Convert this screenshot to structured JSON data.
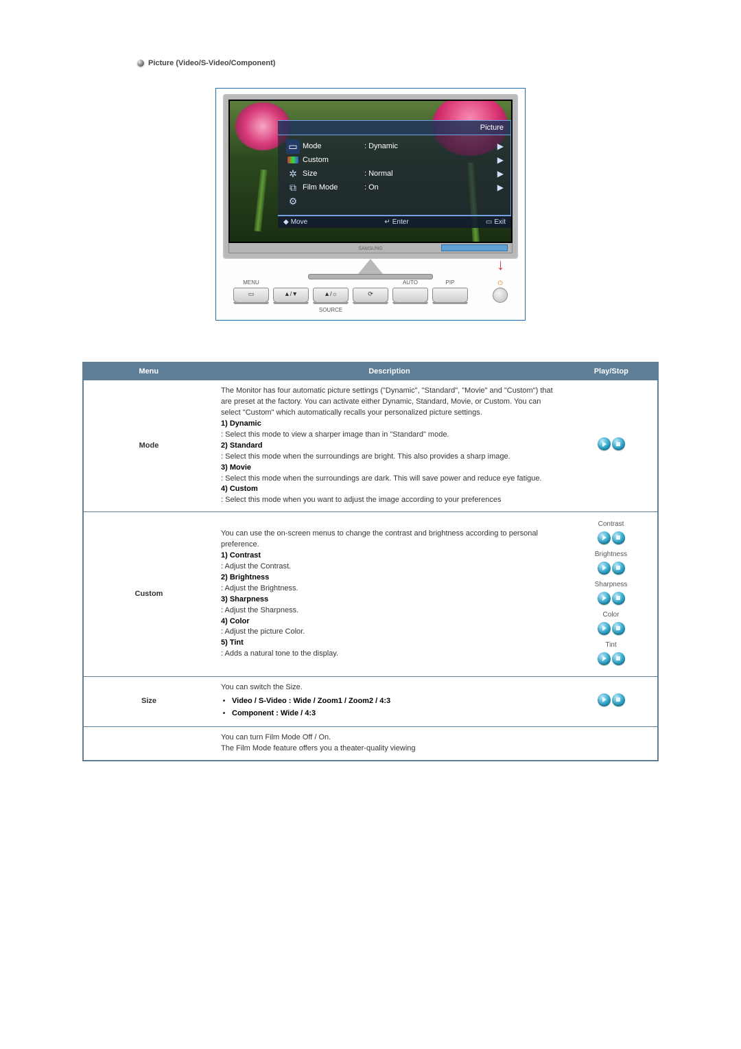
{
  "heading": "Picture (Video/S-Video/Component)",
  "osd": {
    "title": "Picture",
    "items": [
      {
        "label": "Mode",
        "value": ": Dynamic"
      },
      {
        "label": "Custom",
        "value": ""
      },
      {
        "label": "Size",
        "value": ": Normal"
      },
      {
        "label": "Film Mode",
        "value": ": On"
      }
    ],
    "footer": {
      "move": "Move",
      "enter": "Enter",
      "exit": "Exit"
    }
  },
  "remote": {
    "menu": "MENU",
    "auto": "AUTO",
    "pip": "PIP",
    "source": "SOURCE",
    "vol_nav": "▲/▼",
    "bright_nav": "▲/☼",
    "exit_icon": "⟳"
  },
  "monitor_brand": "SAMSUNG",
  "table": {
    "headers": {
      "menu": "Menu",
      "description": "Description",
      "play": "Play/Stop"
    },
    "rows": [
      {
        "menu": "Mode",
        "intro": "The Monitor has four automatic picture settings (\"Dynamic\", \"Standard\", \"Movie\" and \"Custom\") that are preset at the factory. You can activate either Dynamic, Standard, Movie, or Custom. You can select \"Custom\" which automatically recalls your personalized picture settings.",
        "opts": [
          {
            "t": "1) Dynamic",
            "d": ": Select this mode to view a sharper image than in \"Standard\" mode."
          },
          {
            "t": "2) Standard",
            "d": ": Select this mode when the surroundings are bright. This also provides a sharp image."
          },
          {
            "t": "3) Movie",
            "d": ": Select this mode when the surroundings are dark. This will save power and reduce eye fatigue."
          },
          {
            "t": "4) Custom",
            "d": ": Select this mode when you want to adjust the image according to your preferences"
          }
        ],
        "play": [
          {
            "label": ""
          }
        ]
      },
      {
        "menu": "Custom",
        "intro": "You can use the on-screen menus to change the contrast and brightness according to personal preference.",
        "opts": [
          {
            "t": "1) Contrast",
            "d": ": Adjust the Contrast."
          },
          {
            "t": "2) Brightness",
            "d": ": Adjust the Brightness."
          },
          {
            "t": "3) Sharpness",
            "d": ": Adjust the Sharpness."
          },
          {
            "t": "4) Color",
            "d": ": Adjust the picture Color."
          },
          {
            "t": "5) Tint",
            "d": ": Adds a natural tone to the display."
          }
        ],
        "play": [
          {
            "label": "Contrast"
          },
          {
            "label": "Brightness"
          },
          {
            "label": "Sharpness"
          },
          {
            "label": "Color"
          },
          {
            "label": "Tint"
          }
        ]
      },
      {
        "menu": "Size",
        "intro": "You can switch the Size.",
        "bullets": [
          "Video / S-Video : Wide / Zoom1 / Zoom2 / 4:3",
          "Component : Wide / 4:3"
        ],
        "play": [
          {
            "label": ""
          }
        ]
      },
      {
        "menu": "",
        "intro2a": "You can turn Film Mode Off / On.",
        "intro2b": "The Film Mode feature offers you a theater-quality viewing"
      }
    ]
  }
}
